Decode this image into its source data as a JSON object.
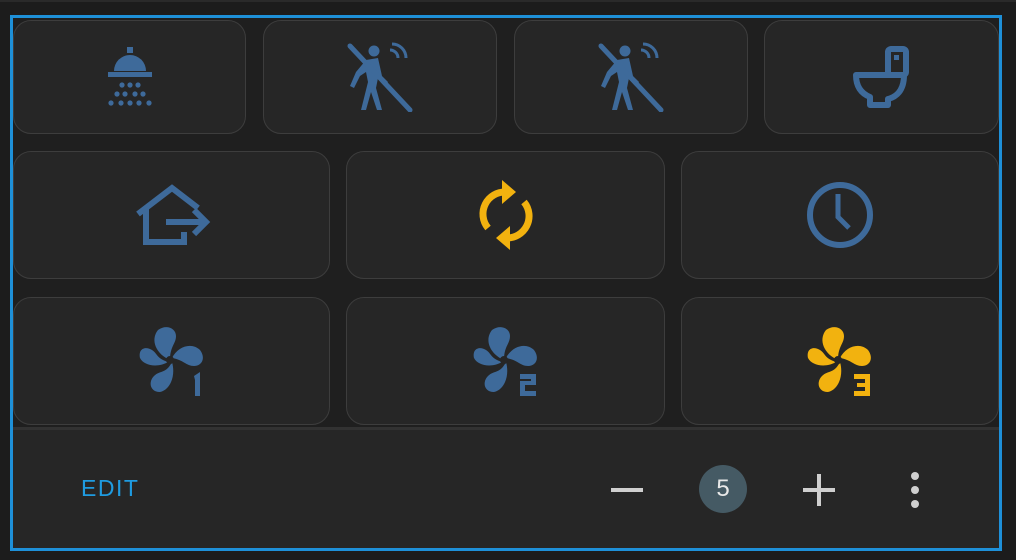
{
  "colors": {
    "accent": "#1f9be0",
    "icon_blue": "#3e6a9a",
    "icon_amber": "#f2b20f",
    "badge_bg": "#455a64",
    "border": "#1e90d8"
  },
  "tiles": [
    {
      "icon": "shower-icon",
      "color": "icon_blue"
    },
    {
      "icon": "motion-sensor-off-icon",
      "color": "icon_blue"
    },
    {
      "icon": "motion-sensor-off-icon",
      "color": "icon_blue"
    },
    {
      "icon": "toilet-icon",
      "color": "icon_blue"
    },
    {
      "icon": "home-export-icon",
      "color": "icon_blue"
    },
    {
      "icon": "sync-icon",
      "color": "icon_amber"
    },
    {
      "icon": "clock-icon",
      "color": "icon_blue"
    },
    {
      "icon": "fan-speed-1-icon",
      "color": "icon_blue"
    },
    {
      "icon": "fan-speed-2-icon",
      "color": "icon_blue"
    },
    {
      "icon": "fan-speed-3-icon",
      "color": "icon_amber"
    }
  ],
  "footer": {
    "edit_label": "EDIT",
    "count": "5",
    "minus_icon": "minus-icon",
    "plus_icon": "plus-icon",
    "more_icon": "dots-vertical-icon"
  }
}
